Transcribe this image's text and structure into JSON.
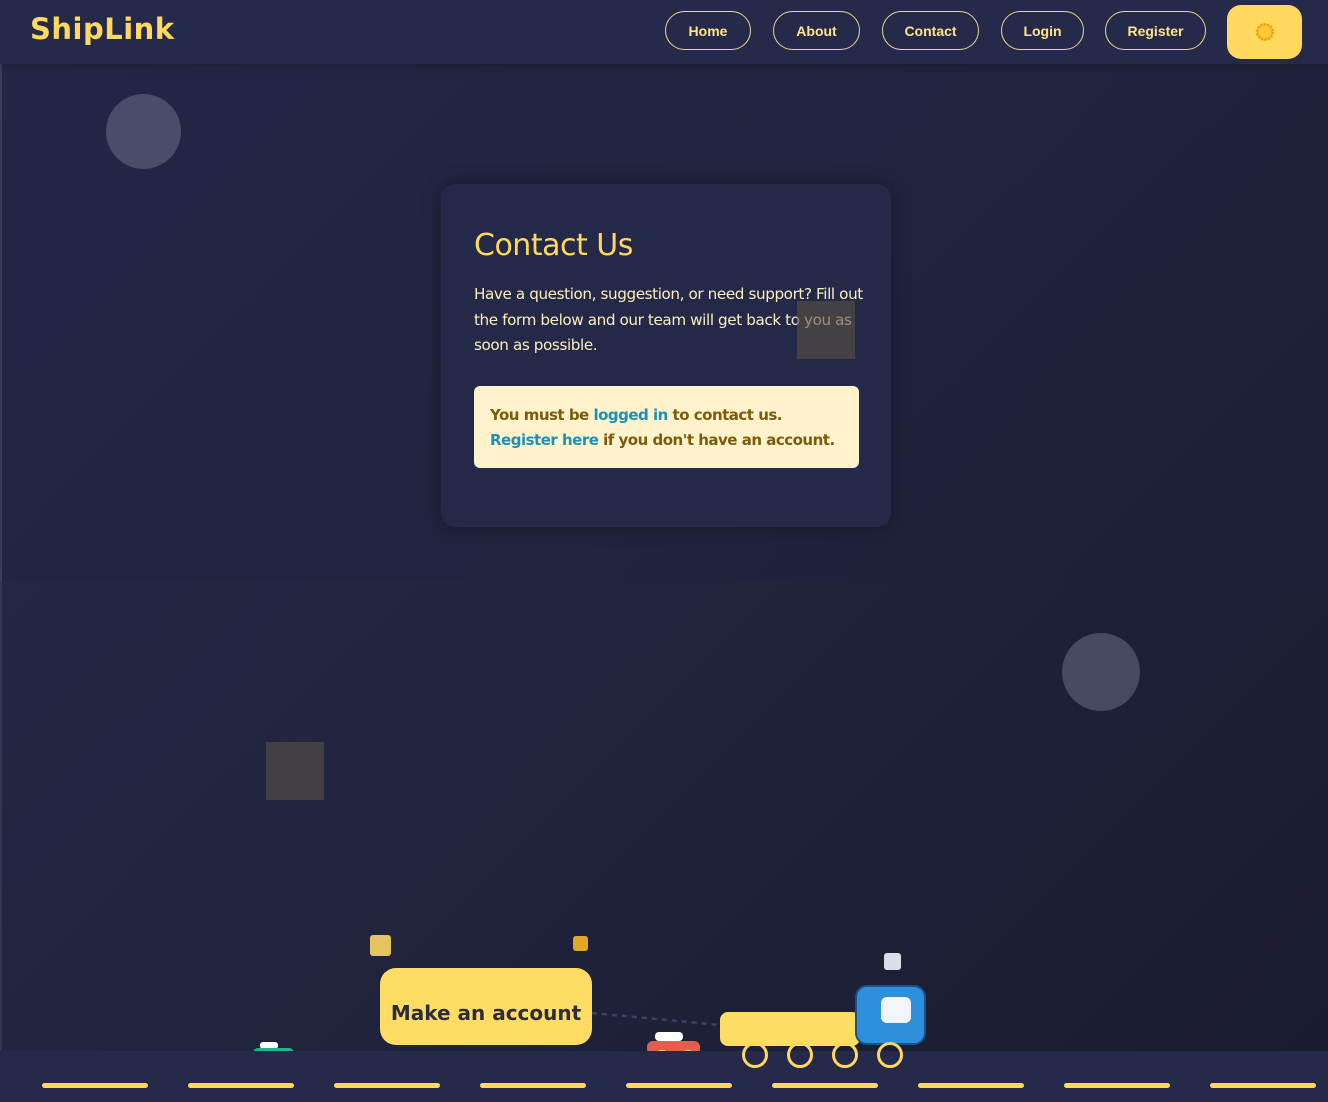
{
  "brand": {
    "name": "ShipLink",
    "accent_color": "#ffd95e"
  },
  "nav": {
    "items": [
      {
        "label": "Home"
      },
      {
        "label": "About"
      },
      {
        "label": "Contact"
      },
      {
        "label": "Login"
      },
      {
        "label": "Register"
      }
    ],
    "theme_toggle_icon": "sun-icon"
  },
  "contact": {
    "title": "Contact Us",
    "description": "Have a question, suggestion, or need support? Fill out the form below and our team will get back to you as soon as possible.",
    "alert": {
      "text_before": "You must be ",
      "login_link": "logged in",
      "text_middle": " to contact us. ",
      "register_link": "Register here",
      "text_after": " if you don't have an account."
    }
  },
  "cta": {
    "label": "Make an account"
  },
  "colors": {
    "background": "#232746",
    "header": "#262a4a",
    "alert_background": "#fef3cd",
    "alert_text": "#7d5b08",
    "link": "#1f8fb5",
    "truck_cab": "#2e8fdd"
  }
}
